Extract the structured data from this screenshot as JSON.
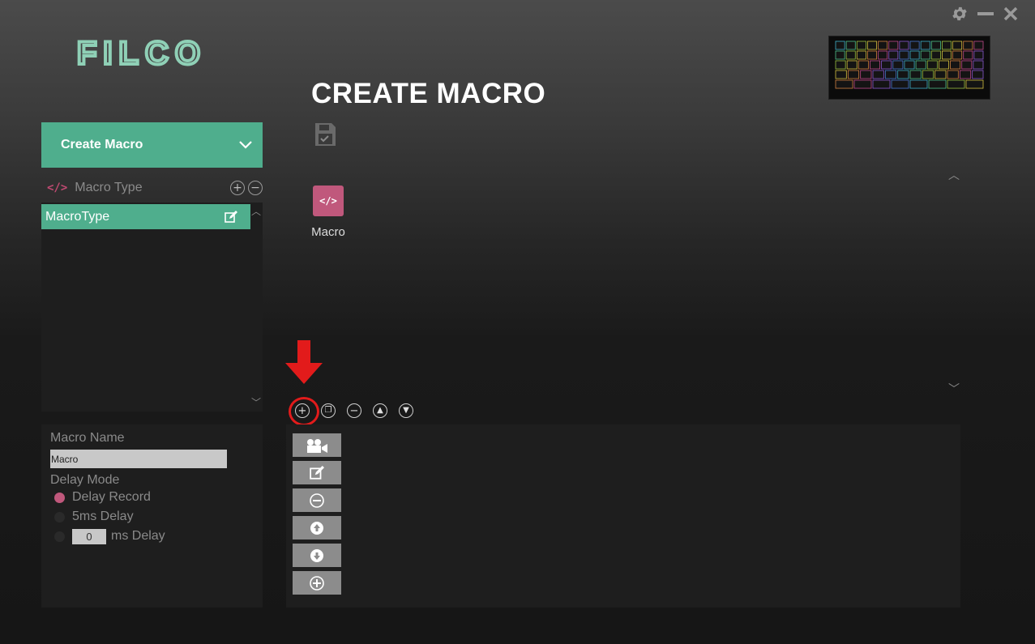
{
  "brand": {
    "logo_text": "FILCO"
  },
  "page": {
    "title": "CREATE MACRO"
  },
  "dropdown": {
    "selected": "Create Macro"
  },
  "macro_type": {
    "header_label": "Macro Type",
    "items": [
      {
        "label": "MacroType"
      }
    ]
  },
  "macro_tiles": [
    {
      "label": "Macro",
      "icon": "code-icon"
    }
  ],
  "settings": {
    "name_label": "Macro Name",
    "name_value": "Macro",
    "delay_mode_label": "Delay Mode",
    "options": [
      {
        "label": "Delay Record",
        "selected": true
      },
      {
        "label": "5ms Delay",
        "selected": false
      },
      {
        "label": "ms Delay",
        "selected": false,
        "value": "0"
      }
    ]
  },
  "toolbar": {
    "icons": [
      "add-icon",
      "copy-icon",
      "remove-icon",
      "move-up-icon",
      "move-down-icon"
    ]
  },
  "side_buttons": [
    "record-icon",
    "edit-icon",
    "remove-icon",
    "move-up-icon",
    "move-down-icon",
    "add-icon"
  ],
  "colors": {
    "accent_green": "#4fae8d",
    "accent_pink": "#c0587c",
    "annotation_red": "#e21b1b"
  }
}
